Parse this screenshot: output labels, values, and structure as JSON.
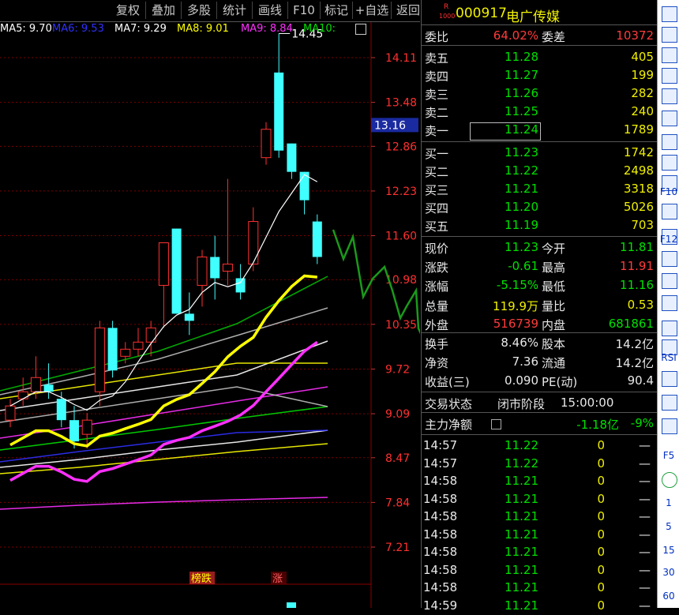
{
  "toolbar": {
    "buttons": [
      "复权",
      "叠加",
      "多股",
      "统计",
      "画线",
      "F10",
      "标记",
      "+自选",
      "返回"
    ]
  },
  "ma_legend": [
    {
      "label": "MA5: 9.70",
      "color": "#ffffff"
    },
    {
      "label": "MA6: 9.53",
      "color": "#3030ff"
    },
    {
      "label": "MA7: 9.29",
      "color": "#ffffff"
    },
    {
      "label": "MA8: 9.01",
      "color": "#ffff00"
    },
    {
      "label": "MA9: 8.84",
      "color": "#ff30ff"
    },
    {
      "label": "MA10:",
      "color": "#00e000"
    }
  ],
  "chart": {
    "price_axis": [
      "14.11",
      "13.48",
      "12.86",
      "12.23",
      "11.60",
      "10.98",
      "10.35",
      "9.72",
      "9.09",
      "8.47",
      "7.84",
      "7.21"
    ],
    "current_price_tag": "13.16",
    "high_marker": "14.45",
    "tags": [
      {
        "text": "榜跌"
      },
      {
        "text": "涨"
      }
    ],
    "candles": [
      {
        "o": 9.0,
        "h": 9.3,
        "l": 8.9,
        "c": 9.2
      },
      {
        "o": 9.3,
        "h": 9.6,
        "l": 9.2,
        "c": 9.4
      },
      {
        "o": 9.4,
        "h": 9.9,
        "l": 9.3,
        "c": 9.6
      },
      {
        "o": 9.5,
        "h": 9.8,
        "l": 9.3,
        "c": 9.4
      },
      {
        "o": 9.3,
        "h": 9.4,
        "l": 8.9,
        "c": 9.0
      },
      {
        "o": 9.0,
        "h": 9.2,
        "l": 8.6,
        "c": 8.7
      },
      {
        "o": 8.8,
        "h": 9.1,
        "l": 8.6,
        "c": 9.0
      },
      {
        "o": 9.4,
        "h": 10.4,
        "l": 9.2,
        "c": 10.3
      },
      {
        "o": 10.3,
        "h": 10.4,
        "l": 9.6,
        "c": 9.7
      },
      {
        "o": 9.9,
        "h": 10.1,
        "l": 9.8,
        "c": 10.0
      },
      {
        "o": 10.0,
        "h": 10.3,
        "l": 9.9,
        "c": 10.1
      },
      {
        "o": 10.1,
        "h": 10.4,
        "l": 9.9,
        "c": 10.3
      },
      {
        "o": 10.9,
        "h": 11.5,
        "l": 10.3,
        "c": 11.5
      },
      {
        "o": 11.7,
        "h": 11.7,
        "l": 10.5,
        "c": 10.5
      },
      {
        "o": 10.5,
        "h": 10.8,
        "l": 10.2,
        "c": 10.4
      },
      {
        "o": 10.9,
        "h": 11.4,
        "l": 10.6,
        "c": 11.3
      },
      {
        "o": 11.3,
        "h": 11.6,
        "l": 10.7,
        "c": 11.0
      },
      {
        "o": 11.1,
        "h": 12.4,
        "l": 10.9,
        "c": 11.2
      },
      {
        "o": 11.0,
        "h": 11.2,
        "l": 10.7,
        "c": 10.8
      },
      {
        "o": 11.2,
        "h": 12.0,
        "l": 11.1,
        "c": 11.8
      },
      {
        "o": 12.7,
        "h": 13.2,
        "l": 12.6,
        "c": 13.1
      },
      {
        "o": 13.9,
        "h": 14.45,
        "l": 12.7,
        "c": 12.8
      },
      {
        "o": 12.9,
        "h": 12.9,
        "l": 12.4,
        "c": 12.5
      },
      {
        "o": 12.5,
        "h": 12.5,
        "l": 11.9,
        "c": 12.1
      },
      {
        "o": 11.8,
        "h": 11.9,
        "l": 11.2,
        "c": 11.3
      }
    ]
  },
  "stock": {
    "code": "000917",
    "name": "电广传媒",
    "badge_top": "R",
    "badge_bottom": "1000"
  },
  "weibi": {
    "label1": "委比",
    "value1": "64.02%",
    "label2": "委差",
    "value2": "10372"
  },
  "asks": [
    {
      "label": "卖五",
      "price": "11.28",
      "vol": "405"
    },
    {
      "label": "卖四",
      "price": "11.27",
      "vol": "199"
    },
    {
      "label": "卖三",
      "price": "11.26",
      "vol": "282"
    },
    {
      "label": "卖二",
      "price": "11.25",
      "vol": "240"
    },
    {
      "label": "卖一",
      "price": "11.24",
      "vol": "1789"
    }
  ],
  "bids": [
    {
      "label": "买一",
      "price": "11.23",
      "vol": "1742"
    },
    {
      "label": "买二",
      "price": "11.22",
      "vol": "2498"
    },
    {
      "label": "买三",
      "price": "11.21",
      "vol": "3318"
    },
    {
      "label": "买四",
      "price": "11.20",
      "vol": "5026"
    },
    {
      "label": "买五",
      "price": "11.19",
      "vol": "703"
    }
  ],
  "quote": [
    {
      "l1": "现价",
      "v1": "11.23",
      "c1": "green",
      "l2": "今开",
      "v2": "11.81",
      "c2": "green"
    },
    {
      "l1": "涨跌",
      "v1": "-0.61",
      "c1": "green",
      "l2": "最高",
      "v2": "11.91",
      "c2": "red"
    },
    {
      "l1": "涨幅",
      "v1": "-5.15%",
      "c1": "green",
      "l2": "最低",
      "v2": "11.16",
      "c2": "green"
    },
    {
      "l1": "总量",
      "v1": "119.9万",
      "c1": "yellow",
      "l2": "量比",
      "v2": "0.53",
      "c2": "yellow"
    },
    {
      "l1": "外盘",
      "v1": "516739",
      "c1": "red",
      "l2": "内盘",
      "v2": "681861",
      "c2": "green"
    },
    {
      "l1": "换手",
      "v1": "8.46%",
      "c1": "white",
      "l2": "股本",
      "v2": "14.2亿",
      "c2": "white"
    },
    {
      "l1": "净资",
      "v1": "7.36",
      "c1": "white",
      "l2": "流通",
      "v2": "14.2亿",
      "c2": "white"
    },
    {
      "l1": "收益(三)",
      "v1": "0.090",
      "c1": "white",
      "l2": "PE(动)",
      "v2": "90.4",
      "c2": "white"
    }
  ],
  "trade_status": {
    "label": "交易状态",
    "phase": "闭市阶段",
    "time": "15:00:00"
  },
  "main_net": {
    "label": "主力净额",
    "value": "-1.18亿",
    "pct": "-9%"
  },
  "ticks": [
    {
      "time": "14:57",
      "price": "11.22",
      "vol": "0",
      "flag": "—"
    },
    {
      "time": "14:57",
      "price": "11.22",
      "vol": "0",
      "flag": "—"
    },
    {
      "time": "14:58",
      "price": "11.21",
      "vol": "0",
      "flag": "—"
    },
    {
      "time": "14:58",
      "price": "11.21",
      "vol": "0",
      "flag": "—"
    },
    {
      "time": "14:58",
      "price": "11.21",
      "vol": "0",
      "flag": "—"
    },
    {
      "time": "14:58",
      "price": "11.21",
      "vol": "0",
      "flag": "—"
    },
    {
      "time": "14:58",
      "price": "11.21",
      "vol": "0",
      "flag": "—"
    },
    {
      "time": "14:58",
      "price": "11.21",
      "vol": "0",
      "flag": "—"
    },
    {
      "time": "14:58",
      "price": "11.21",
      "vol": "0",
      "flag": "—"
    },
    {
      "time": "14:59",
      "price": "11.21",
      "vol": "0",
      "flag": "—"
    }
  ],
  "iconbar": {
    "labels": [
      "F10",
      "F12",
      "RSI",
      "F5",
      "1",
      "5",
      "15",
      "30",
      "60"
    ]
  }
}
